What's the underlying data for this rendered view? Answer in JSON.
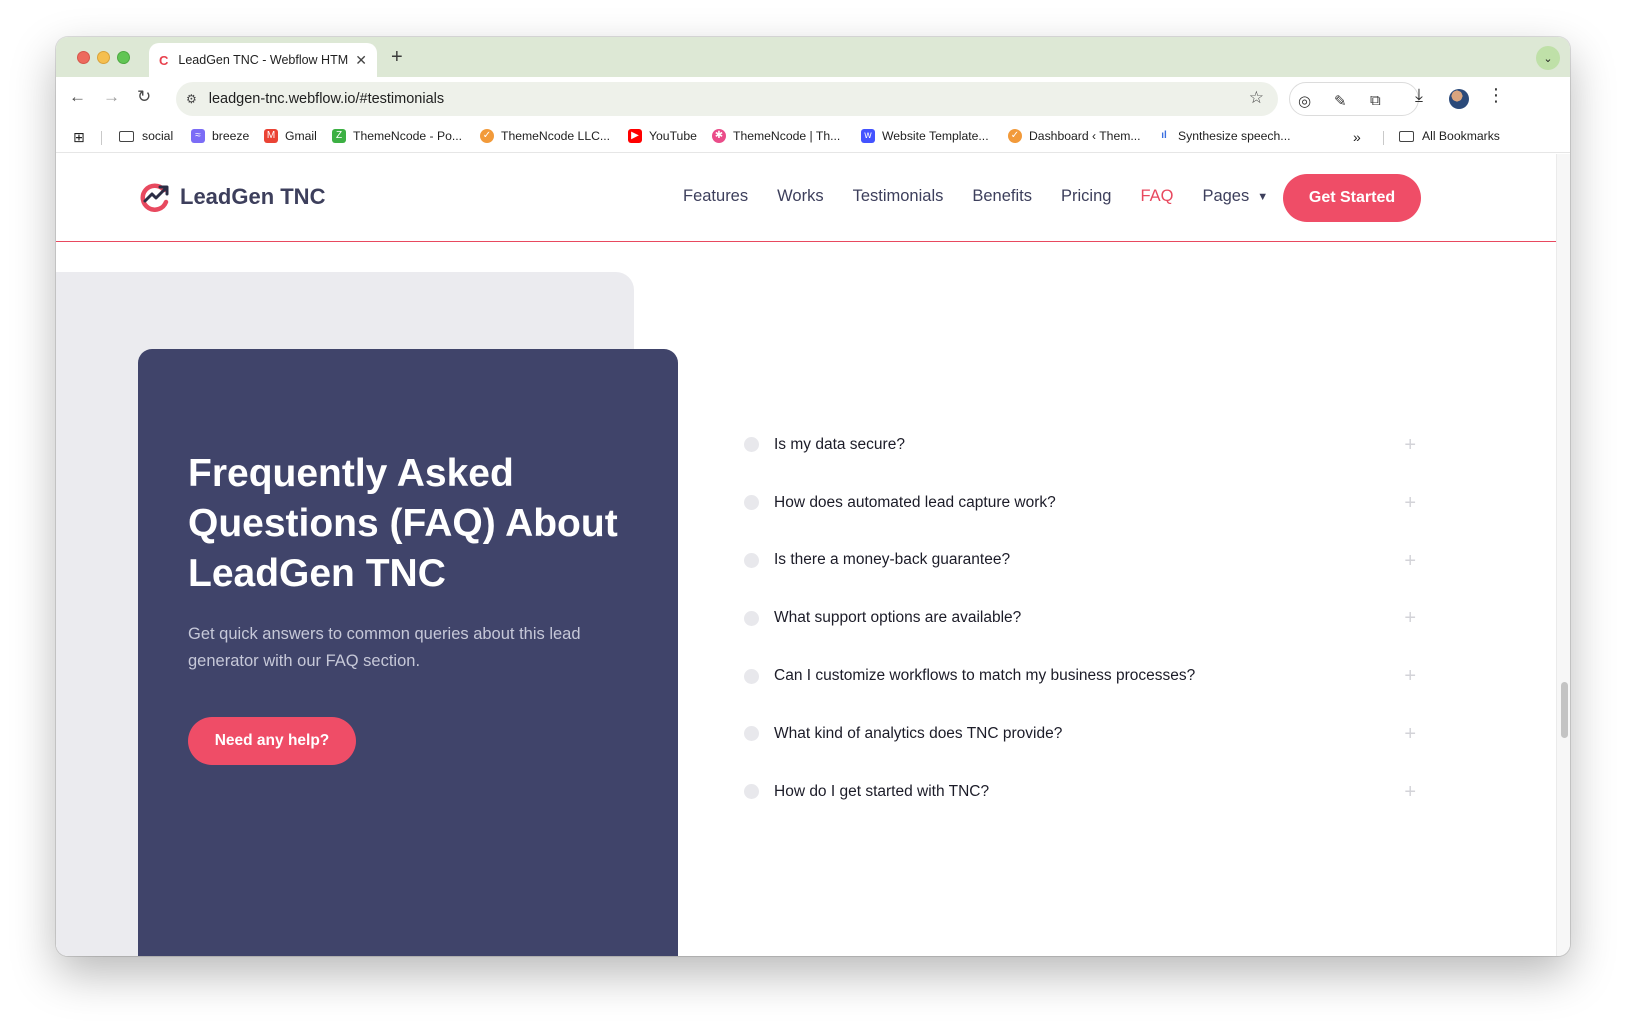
{
  "browser": {
    "tab_title": "LeadGen TNC - Webflow HTML website template",
    "tab_favicon": "C",
    "tab_close": "✕",
    "new_tab": "+",
    "tabs_menu": "⌄",
    "url": "leadgen-tnc.webflow.io/#testimonials",
    "nav": {
      "back": "←",
      "forward": "→",
      "reload": "↻"
    },
    "star": "☆",
    "menu": "⋮",
    "download": "⤓",
    "extensions": [
      "grammar-icon",
      "eyedropper-icon",
      "puzzle-icon"
    ]
  },
  "bookmarks": {
    "items": [
      {
        "label": "social",
        "icon": "folder-icon"
      },
      {
        "label": "breeze",
        "icon": "breeze-icon",
        "color": "#7b6cf6"
      },
      {
        "label": "Gmail",
        "icon": "gmail-icon",
        "color": "#ea4335"
      },
      {
        "label": "ThemeNcode - Po...",
        "icon": "themencode-icon",
        "color": "#3cb043"
      },
      {
        "label": "ThemeNcode LLC...",
        "icon": "upwork-icon",
        "color": "#f29a3a"
      },
      {
        "label": "YouTube",
        "icon": "youtube-icon",
        "color": "#ff0000"
      },
      {
        "label": "ThemeNcode | Th...",
        "icon": "dribbble-icon",
        "color": "#ea4c89"
      },
      {
        "label": "Website Template...",
        "icon": "webflow-icon",
        "color": "#4353ff"
      },
      {
        "label": "Dashboard ‹ Them...",
        "icon": "dashboard-icon",
        "color": "#f29a3a"
      },
      {
        "label": "Synthesize speech...",
        "icon": "speech-icon",
        "color": "#3b6fe0"
      }
    ],
    "overflow": "»",
    "all_bookmarks": "All Bookmarks"
  },
  "site": {
    "logo_text": "LeadGen TNC",
    "nav": [
      "Features",
      "Works",
      "Testimonials",
      "Benefits",
      "Pricing",
      "FAQ",
      "Pages"
    ],
    "active_nav": "FAQ",
    "pages_chevron": "⌄",
    "cta": "Get Started",
    "accent": "#ef4d67",
    "dark": "#40446a"
  },
  "faq": {
    "title": "Frequently Asked Questions (FAQ) About LeadGen TNC",
    "subtitle": "Get quick answers to common queries about this lead generator with our FAQ section.",
    "button": "Need any help?",
    "questions": [
      "Is my data secure?",
      "How does automated lead capture work?",
      "Is there a money-back guarantee?",
      "What support options are available?",
      "Can I customize workflows to match my business processes?",
      "What kind of analytics does TNC provide?",
      "How do I get started with TNC?"
    ],
    "expand_glyph": "+"
  }
}
